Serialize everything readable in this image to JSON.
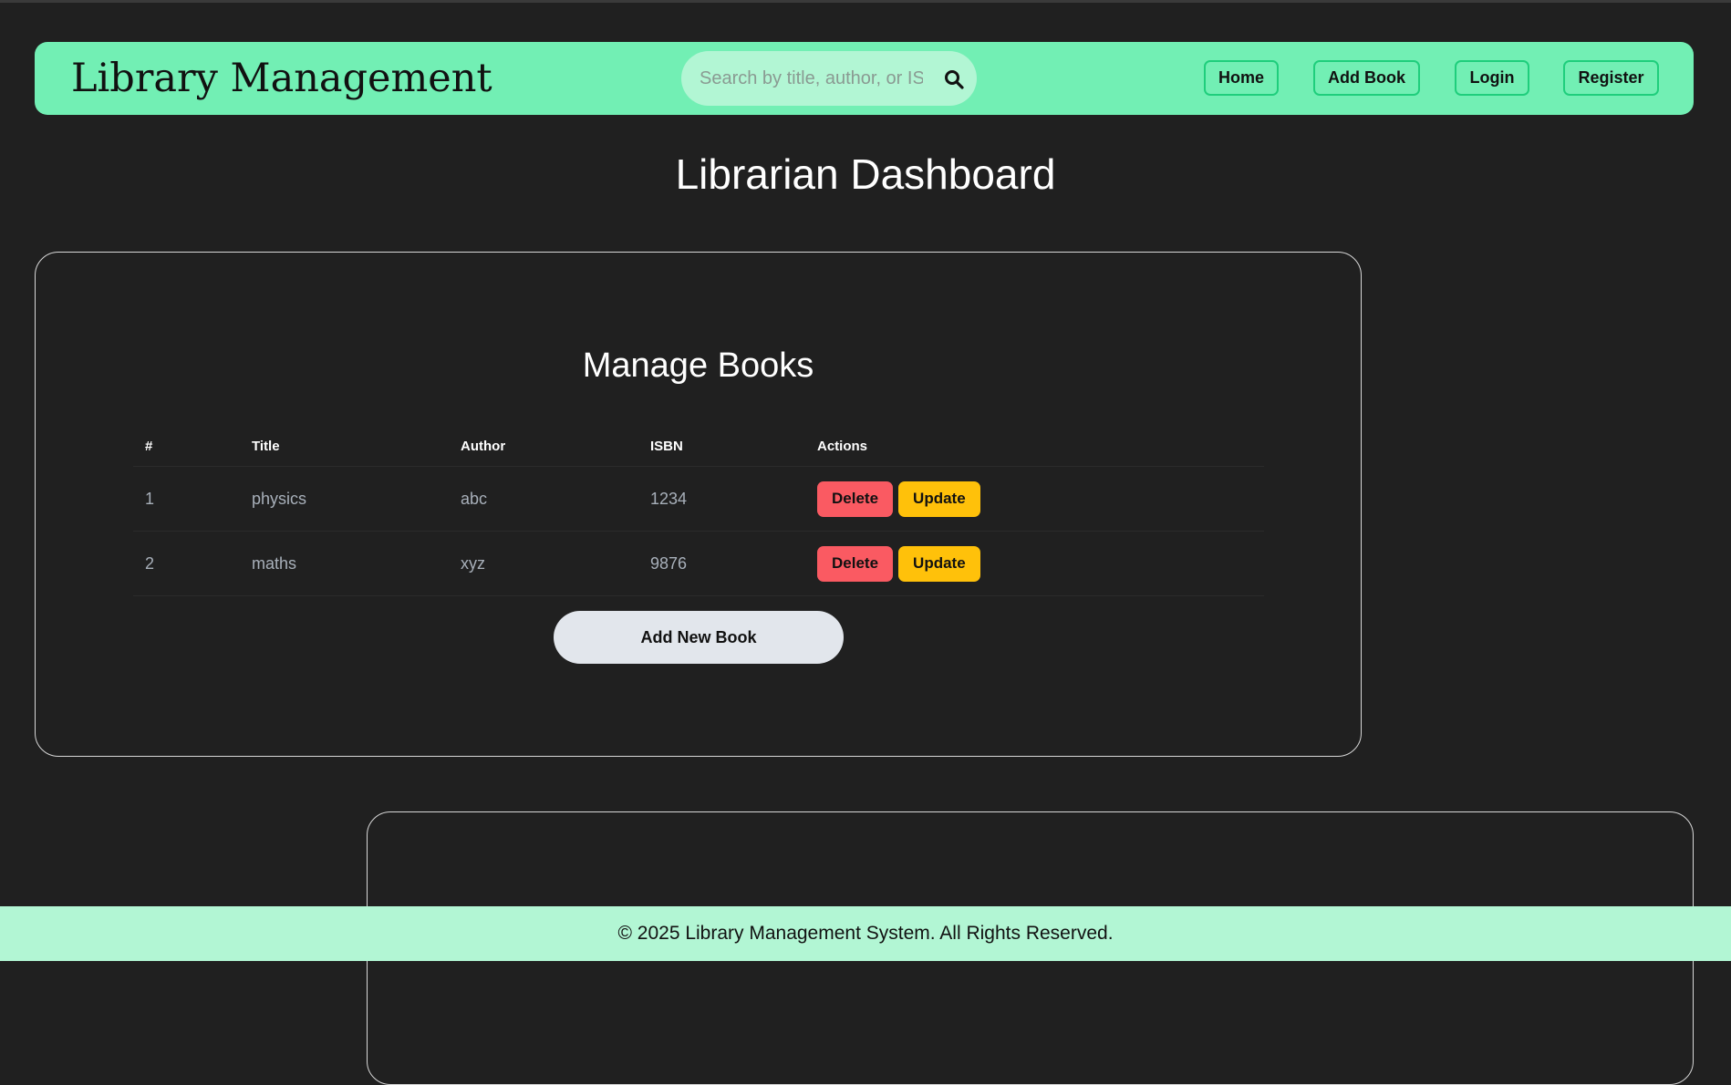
{
  "navbar": {
    "brand": "Library Management",
    "search_placeholder": "Search by title, author, or ISBN",
    "links": {
      "home": "Home",
      "add_book": "Add Book",
      "login": "Login",
      "register": "Register"
    }
  },
  "page_title": "Librarian Dashboard",
  "manage_books": {
    "title": "Manage Books",
    "columns": {
      "num": "#",
      "title": "Title",
      "author": "Author",
      "isbn": "ISBN",
      "actions": "Actions"
    },
    "rows": [
      {
        "num": "1",
        "title": "physics",
        "author": "abc",
        "isbn": "1234",
        "delete": "Delete",
        "update": "Update"
      },
      {
        "num": "2",
        "title": "maths",
        "author": "xyz",
        "isbn": "9876",
        "delete": "Delete",
        "update": "Update"
      }
    ],
    "add_button": "Add New Book"
  },
  "footer": {
    "text": "© 2025 Library Management System. All Rights Reserved."
  },
  "colors": {
    "background": "#202020",
    "navbar": "#72efb4",
    "search_bg": "#b2f6d4",
    "nav_border": "#1fce7c",
    "delete": "#fa5a62",
    "update": "#ffc10a",
    "footer": "#b2f6d4"
  },
  "icons": {
    "search": "search-icon"
  }
}
